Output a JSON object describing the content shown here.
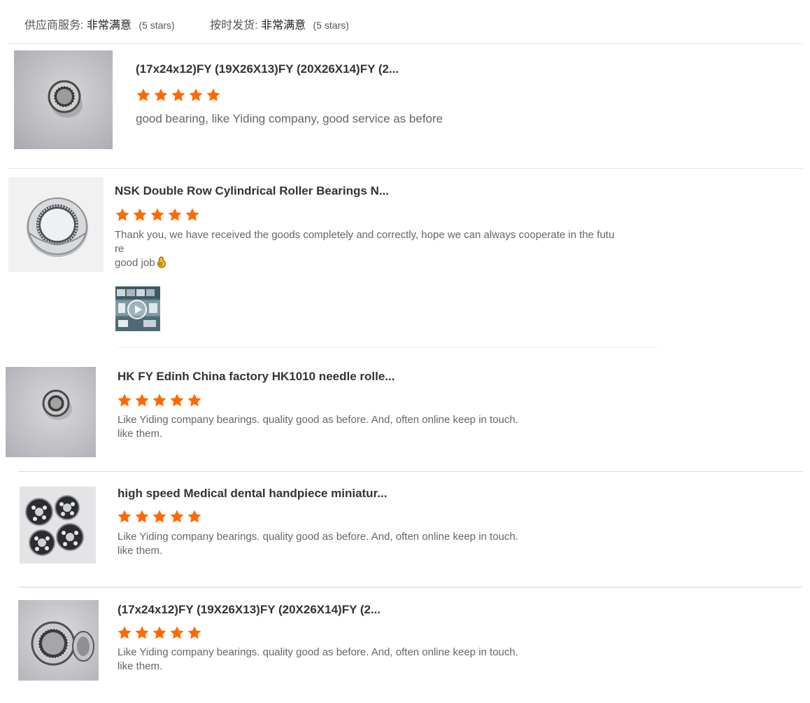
{
  "summary": {
    "supplier_label": "供应商服务:",
    "supplier_value": "非常满意",
    "supplier_stars": "(5 stars)",
    "shipping_label": "按时发货:",
    "shipping_value": "非常满意",
    "shipping_stars": "(5 stars)"
  },
  "colors": {
    "star": "#ff6a00",
    "divider": "#e6e6e6"
  },
  "reviews": [
    {
      "title": "(17x24x12)FY (19X26X13)FY (20X26X14)FY (2...",
      "rating": 5,
      "comment_lines": [
        "good bearing, like Yiding company, good service as before"
      ]
    },
    {
      "title": "NSK Double Row Cylindrical Roller Bearings N...",
      "rating": 5,
      "comment_lines": [
        "Thank you, we have received the goods completely and correctly, hope we can always cooperate in the futu",
        "re",
        "good job"
      ],
      "emoji": "ok-hand-emoji",
      "has_video": true
    },
    {
      "title": "HK FY Edinh China factory HK1010 needle rolle...",
      "rating": 5,
      "comment_lines": [
        "Like Yiding company bearings. quality good as before. And, often online keep in touch.",
        "like them."
      ]
    },
    {
      "title": "high speed Medical dental handpiece miniatur...",
      "rating": 5,
      "comment_lines": [
        "Like Yiding company bearings. quality good as before. And, often online keep in touch.",
        "like them."
      ]
    },
    {
      "title": "(17x24x12)FY (19X26X13)FY (20X26X14)FY (2...",
      "rating": 5,
      "comment_lines": [
        "Like Yiding company bearings. quality good as before. And, often online keep in touch.",
        "like them."
      ]
    }
  ]
}
